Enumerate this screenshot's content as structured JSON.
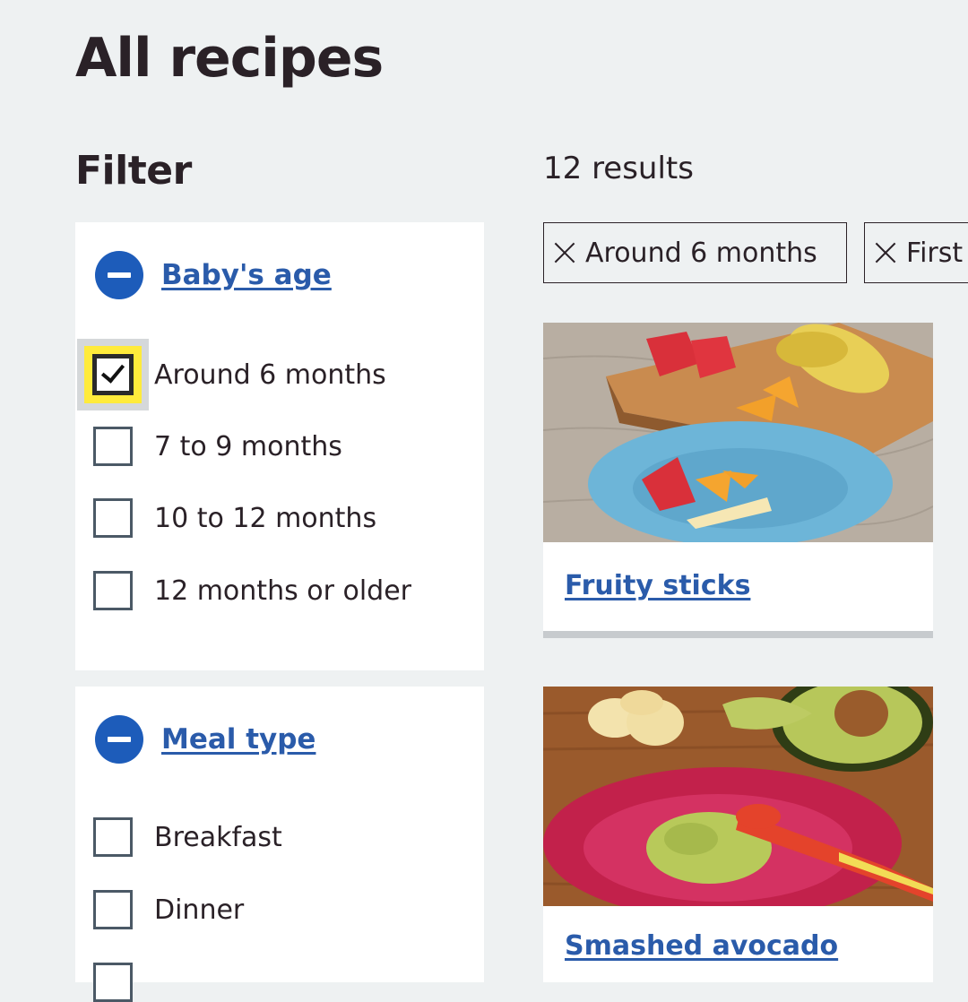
{
  "page": {
    "title": "All recipes"
  },
  "filter": {
    "heading": "Filter",
    "groups": [
      {
        "label": "Baby's age",
        "options": [
          {
            "label": "Around 6 months",
            "checked": true
          },
          {
            "label": "7 to 9 months",
            "checked": false
          },
          {
            "label": "10 to 12 months",
            "checked": false
          },
          {
            "label": "12 months or older",
            "checked": false
          }
        ]
      },
      {
        "label": "Meal type",
        "options": [
          {
            "label": "Breakfast",
            "checked": false
          },
          {
            "label": "Dinner",
            "checked": false
          }
        ]
      }
    ]
  },
  "results": {
    "count_text": "12 results",
    "active_filters": [
      "Around 6 months",
      "First"
    ]
  },
  "recipes": [
    {
      "title": "Fruity sticks",
      "image": "fruit-plate-photo"
    },
    {
      "title": "Smashed avocado",
      "image": "avocado-plate-photo"
    }
  ],
  "colors": {
    "background": "#eef1f2",
    "link": "#2a5baa",
    "accent_blue": "#1d5cba",
    "focus_yellow": "#ffeb3b"
  }
}
